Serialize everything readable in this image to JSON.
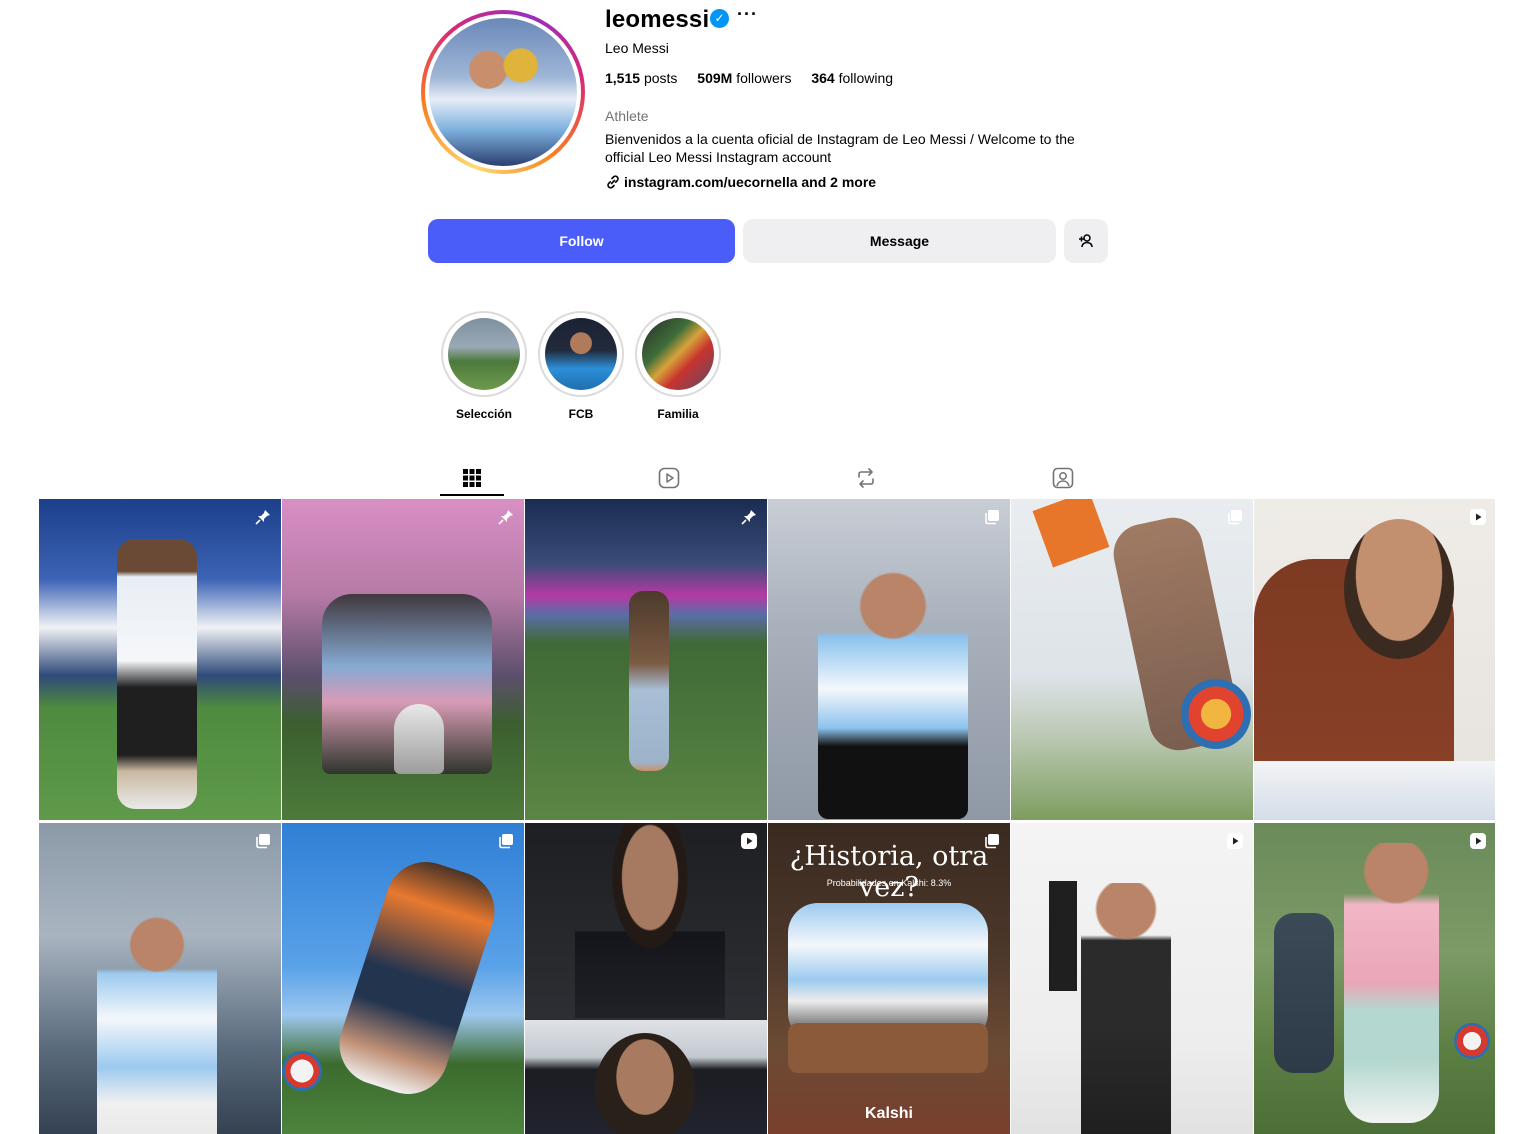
{
  "profile": {
    "username": "leomessi",
    "verified_icon": "✓",
    "more_icon": "···",
    "full_name": "Leo Messi",
    "stats": {
      "posts_count": "1,515",
      "posts_label": "posts",
      "followers_count": "509M",
      "followers_label": "followers",
      "following_count": "364",
      "following_label": "following"
    },
    "category": "Athlete",
    "bio": "Bienvenidos a la cuenta oficial de Instagram de Leo Messi / Welcome to the official Leo Messi Instagram account",
    "link_text": "instagram.com/uecornella and 2 more"
  },
  "actions": {
    "follow_label": "Follow",
    "message_label": "Message"
  },
  "highlights": [
    {
      "label": "Selección"
    },
    {
      "label": "FCB"
    },
    {
      "label": "Familia"
    }
  ],
  "tabs": [
    "posts-grid-icon",
    "reels-icon",
    "reposts-icon",
    "tagged-icon"
  ],
  "posts": [
    {
      "badge": "pin"
    },
    {
      "badge": "pin"
    },
    {
      "badge": "pin"
    },
    {
      "badge": "carousel"
    },
    {
      "badge": "carousel"
    },
    {
      "badge": "reel"
    },
    {
      "badge": "carousel"
    },
    {
      "badge": "carousel"
    },
    {
      "badge": "reel"
    },
    {
      "badge": "carousel",
      "overlay_title": "¿Historia, otra vez?",
      "overlay_sub": "Probabilidades en Kalshi: 8.3%",
      "overlay_brand": "Kalshi"
    },
    {
      "badge": "reel"
    },
    {
      "badge": "reel"
    }
  ],
  "colors": {
    "follow_button": "#4a5df9",
    "secondary_button": "#efeff1",
    "verified": "#0095f6",
    "muted_text": "#737373"
  }
}
